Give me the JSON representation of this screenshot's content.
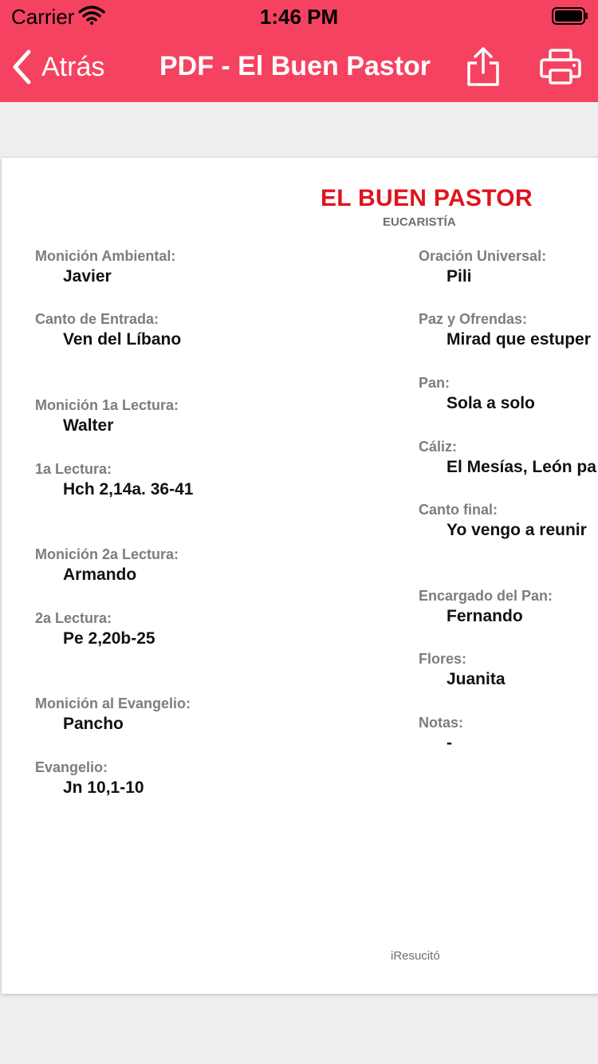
{
  "status_bar": {
    "carrier": "Carrier",
    "time": "1:46 PM"
  },
  "nav": {
    "back_label": "Atrás",
    "title": "PDF - El Buen Pastor"
  },
  "colors": {
    "header": "#f54260",
    "title_red": "#e0131d"
  },
  "document": {
    "title": "EL BUEN PASTOR",
    "subtitle": "EUCARISTÍA",
    "left": [
      {
        "label": "Monición Ambiental:",
        "value": "Javier"
      },
      {
        "label": "Canto de Entrada:",
        "value": "Ven del Líbano"
      },
      {
        "label": "Monición 1a Lectura:",
        "value": "Walter"
      },
      {
        "label": "1a Lectura:",
        "value": "Hch 2,14a. 36-41"
      },
      {
        "label": "Monición 2a Lectura:",
        "value": "Armando"
      },
      {
        "label": "2a Lectura:",
        "value": "Pe 2,20b-25"
      },
      {
        "label": "Monición al Evangelio:",
        "value": "Pancho"
      },
      {
        "label": "Evangelio:",
        "value": "Jn 10,1-10"
      }
    ],
    "right": [
      {
        "label": "Oración Universal:",
        "value": "Pili"
      },
      {
        "label": "Paz y Ofrendas:",
        "value": "Mirad que estuper"
      },
      {
        "label": "Pan:",
        "value": "Sola a solo"
      },
      {
        "label": "Cáliz:",
        "value": "El Mesías, León pa"
      },
      {
        "label": "Canto final:",
        "value": "Yo vengo a reunir"
      },
      {
        "label": "Encargado del Pan:",
        "value": "Fernando"
      },
      {
        "label": "Flores:",
        "value": "Juanita"
      },
      {
        "label": "Notas:",
        "value": "-"
      }
    ],
    "footer": "iResucitó"
  }
}
